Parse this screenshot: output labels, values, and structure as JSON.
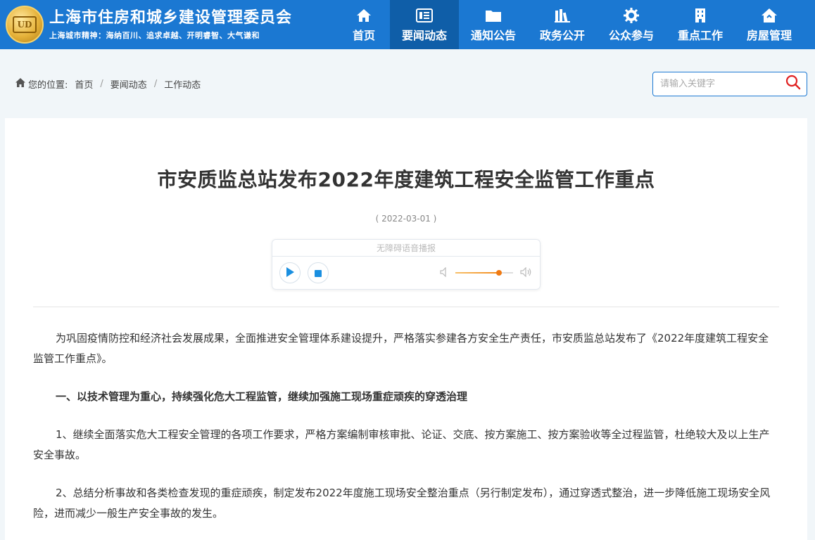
{
  "header": {
    "site_title": "上海市住房和城乡建设管理委员会",
    "slogan": "上海城市精神：海纳百川、追求卓越、开明睿智、大气谦和",
    "nav": [
      {
        "label": "首页",
        "icon": "home-icon"
      },
      {
        "label": "要闻动态",
        "icon": "news-icon",
        "active": true
      },
      {
        "label": "通知公告",
        "icon": "folder-icon"
      },
      {
        "label": "政务公开",
        "icon": "books-icon"
      },
      {
        "label": "公众参与",
        "icon": "gear-icon"
      },
      {
        "label": "重点工作",
        "icon": "building-icon"
      },
      {
        "label": "房屋管理",
        "icon": "house-icon"
      }
    ]
  },
  "breadcrumb": {
    "prefix": "您的位置:",
    "items": [
      "首页",
      "要闻动态",
      "工作动态"
    ]
  },
  "search": {
    "placeholder": "请输入关键字"
  },
  "article": {
    "title": "市安质监总站发布2022年度建筑工程安全监管工作重点",
    "date": "( 2022-03-01 )",
    "player_label": "无障碍语音播报",
    "volume_level": 0.75,
    "paragraphs": [
      "为巩固疫情防控和经济社会发展成果，全面推进安全管理体系建设提升，严格落实参建各方安全生产责任，市安质监总站发布了《2022年度建筑工程安全监管工作重点》。",
      "一、以技术管理为重心，持续强化危大工程监管，继续加强施工现场重症顽疾的穿透治理",
      "1、继续全面落实危大工程安全管理的各项工作要求，严格方案编制审核审批、论证、交底、按方案施工、按方案验收等全过程监管，杜绝较大及以上生产安全事故。",
      "2、总结分析事故和各类检查发现的重症顽疾，制定发布2022年度施工现场安全整治重点（另行制定发布），通过穿透式整治，进一步降低施工现场安全风险，进而减少一般生产安全事故的发生。"
    ]
  },
  "colors": {
    "brand": "#1b78d2",
    "nav_active": "#0f5ea8",
    "search_icon": "#e02020",
    "play_icon": "#1a8fe0"
  }
}
